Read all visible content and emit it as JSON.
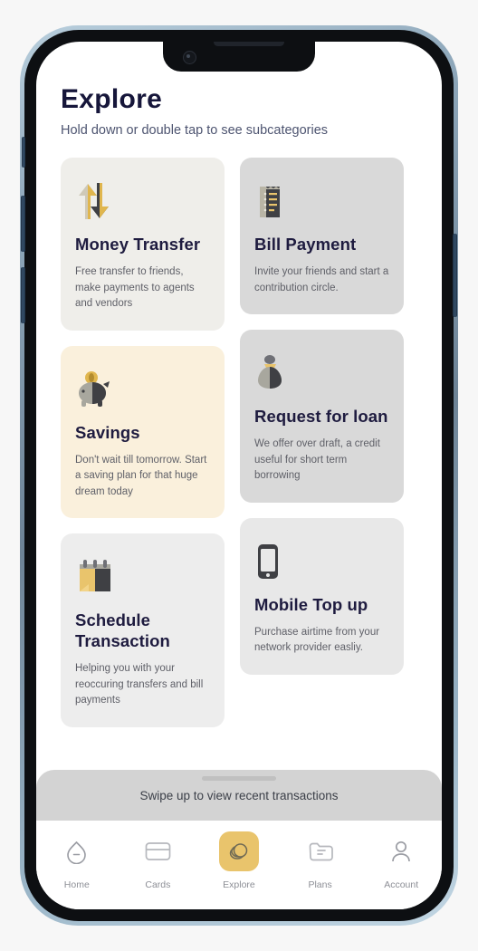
{
  "header": {
    "title": "Explore",
    "subtitle": "Hold down or double tap to see subcategories"
  },
  "cards": [
    {
      "icon": "transfer-arrows-icon",
      "title": "Money Transfer",
      "desc": "Free transfer to friends, make payments to agents and vendors",
      "bg": "#efeeea"
    },
    {
      "icon": "receipt-icon",
      "title": "Bill Payment",
      "desc": "Invite your friends and start a contribution circle.",
      "bg": "#d9d9d9"
    },
    {
      "icon": "piggy-bank-icon",
      "title": "Savings",
      "desc": "Don't wait till tomorrow. Start a saving plan for that huge dream today",
      "bg": "#faf0dc"
    },
    {
      "icon": "money-bag-icon",
      "title": "Request for loan",
      "desc": "We offer over draft, a credit useful for short term borrowing",
      "bg": "#d9d9d9"
    },
    {
      "icon": "calendar-icon",
      "title": "Schedule Transaction",
      "desc": "Helping you with your reoccuring transfers and bill payments",
      "bg": "#ededed"
    },
    {
      "icon": "smartphone-icon",
      "title": "Mobile Top up",
      "desc": "Purchase airtime from your network provider easliy.",
      "bg": "#e8e8e8"
    }
  ],
  "sheet": {
    "text": "Swipe up to view recent transactions"
  },
  "navbar": {
    "items": [
      {
        "label": "Home",
        "icon": "home-icon",
        "active": false
      },
      {
        "label": "Cards",
        "icon": "card-icon",
        "active": false
      },
      {
        "label": "Explore",
        "icon": "coins-icon",
        "active": true
      },
      {
        "label": "Plans",
        "icon": "folder-icon",
        "active": false
      },
      {
        "label": "Account",
        "icon": "person-icon",
        "active": false
      }
    ],
    "active_color": "#e9c46c"
  },
  "theme": {
    "title_color": "#1e1b3f",
    "subtitle_color": "#4d5470",
    "desc_color": "#5f6068",
    "gold": "#e9c46c",
    "dark": "#3f4044"
  }
}
